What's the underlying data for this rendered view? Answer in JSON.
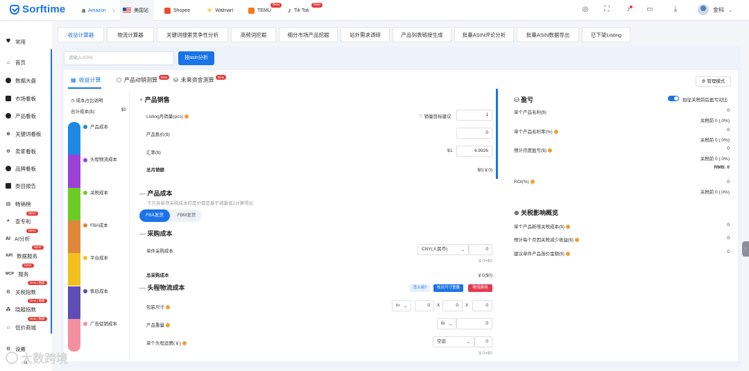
{
  "brand": {
    "name": "Sorftime",
    "color": "#1a73e8"
  },
  "platforms": [
    {
      "label": "Amazon",
      "icon": "amazon-icon",
      "active": true
    },
    {
      "label": "美国站",
      "icon": "us-flag-icon"
    },
    {
      "label": "Shopee",
      "icon": "shopee-icon"
    },
    {
      "label": "Walmart",
      "icon": "walmart-icon"
    },
    {
      "label": "TEMU",
      "icon": "temu-icon",
      "badge": "Beta"
    },
    {
      "label": "Tik Tok",
      "icon": "tiktok-icon",
      "badge": "New"
    }
  ],
  "header_user": {
    "name": "金科"
  },
  "sidebar": [
    {
      "label": "常用",
      "icon": "pin-icon"
    },
    {
      "label": "首页",
      "icon": "home-icon"
    },
    {
      "label": "数据大盘",
      "icon": "dashboard-icon"
    },
    {
      "label": "市场看板",
      "icon": "market-icon"
    },
    {
      "label": "产品看板",
      "icon": "product-icon"
    },
    {
      "label": "关键词看板",
      "icon": "keyword-icon"
    },
    {
      "label": "卖家看板",
      "icon": "seller-icon"
    },
    {
      "label": "品牌看板",
      "icon": "brand-icon"
    },
    {
      "label": "类目报告",
      "icon": "report-icon"
    },
    {
      "label": "畅销榜",
      "icon": "rank-icon"
    },
    {
      "label": "查专利",
      "icon": "patent-icon",
      "badge": "NEW"
    },
    {
      "label": "AI分析",
      "icon": "ai-icon",
      "badge": "NEW",
      "prefix": "AI"
    },
    {
      "label": "数据服务",
      "icon": "api-icon",
      "badge": "NEW",
      "prefix": "API"
    },
    {
      "label": "服务",
      "icon": "mcp-icon",
      "badge": "NEW",
      "prefix": "MCP"
    },
    {
      "label": "关税指数",
      "icon": "tariff-icon",
      "badge": "New | 独家"
    },
    {
      "label": "隐蹤指数",
      "icon": "hidden-icon",
      "badge": "New | 独家"
    },
    {
      "label": "低价商城",
      "icon": "shop-icon",
      "badge": "New | 独家"
    },
    {
      "label": "设置",
      "icon": "settings-icon"
    }
  ],
  "nav_tabs": [
    "收益计算器",
    "物流计算器",
    "关键词搜索竞争性分析",
    "高频词挖掘",
    "细分市场产品挖掘",
    "站外需求调研",
    "产品列表链接生成",
    "批量ASIN评论分析",
    "批量ASIN数据导出",
    "已下架Listing"
  ],
  "search": {
    "placeholder": "请输入ASIN",
    "button": "按asin分析"
  },
  "sub_tabs": [
    {
      "label": "收益计算",
      "icon": "calculator-icon",
      "active": true
    },
    {
      "label": "产品动销测算",
      "icon": "box-icon",
      "badge": "Beta"
    },
    {
      "label": "未来资金测算",
      "icon": "money-icon",
      "badge": "Beta"
    }
  ],
  "manage_mode": "管理模式",
  "cost_panel": {
    "title": "成本占比说明",
    "total_label": "合计成本($):",
    "total_value": "$0",
    "legend": [
      {
        "label": "产品成本",
        "color": "#1e88e5"
      },
      {
        "label": "头程物流成本",
        "color": "#9c40d8"
      },
      {
        "label": "关税成本",
        "color": "#6ccc24"
      },
      {
        "label": "FBA成本",
        "color": "#e0873a"
      },
      {
        "label": "平台成本",
        "color": "#f2c01e"
      },
      {
        "label": "售后成本",
        "color": "#5e4db5"
      },
      {
        "label": "广告促销成本",
        "color": "#f48fa0"
      }
    ]
  },
  "sales": {
    "title": "产品销售",
    "rows": [
      {
        "label": "Listing月销量(pcs)",
        "value": "1",
        "hint": "销量目标建议"
      },
      {
        "label": "产品售价($)",
        "value": "0"
      },
      {
        "label": "汇率($)",
        "value": "6.9926",
        "prefix": "$1:"
      }
    ],
    "total_label": "总月销额",
    "total_value": "$0(￥0)"
  },
  "product_cost": {
    "title": "产品成本",
    "desc": "下方各单项采购成本的是价都是基于销量值1计算得出",
    "ship_tabs": [
      "FBA发货",
      "FBM发货"
    ]
  },
  "purchase": {
    "title": "采购成本",
    "unit_label": "单件采购成本",
    "currency": "CNY(人民币)",
    "unit_value": "0",
    "unit_sub": "￥0=$0",
    "total_label": "总采购成本",
    "total_value": "￥0($0)"
  },
  "logistics": {
    "title": "头程物流成本",
    "buttons": [
      "怎么用?",
      "校对尺寸重量",
      "物流费用"
    ],
    "size_label": "包装尺寸",
    "size_unit": "in",
    "dims": [
      "0",
      "0",
      "0"
    ],
    "weight_label": "产品重量",
    "weight_unit": "lb",
    "weight_value": "0",
    "freight_label": "单个头程运费(￥)",
    "freight_mode": "空运",
    "freight_value": "0",
    "freight_sub": "￥0=$0"
  },
  "profit": {
    "title": "盈亏",
    "toggle_label": "加征关税前后盈亏对比",
    "rows": [
      {
        "label": "单个产品毛利($)",
        "value": "0",
        "sub": "关税前 0 (.0%)"
      },
      {
        "label": "单个产品毛利率(%)",
        "value": "0",
        "sub": "关税前 0 (.0%)"
      },
      {
        "label": "预计月度盈亏($)",
        "value": "0",
        "sub": "关税前 0 (.0%)",
        "extra": "RMB: 0"
      },
      {
        "label": "ROI(%)",
        "value": "0",
        "sub": "关税前 0 (.0%)"
      }
    ]
  },
  "tariff": {
    "title": "关税影响概览",
    "rows": [
      {
        "label": "单个产品新增关税成本($)",
        "value": "0"
      },
      {
        "label": "预计每个月因关税减少收益($)",
        "value": "0"
      },
      {
        "label": "建议单件产品涨价金额($)",
        "value": "0"
      }
    ]
  },
  "watermark": "大数跨境"
}
